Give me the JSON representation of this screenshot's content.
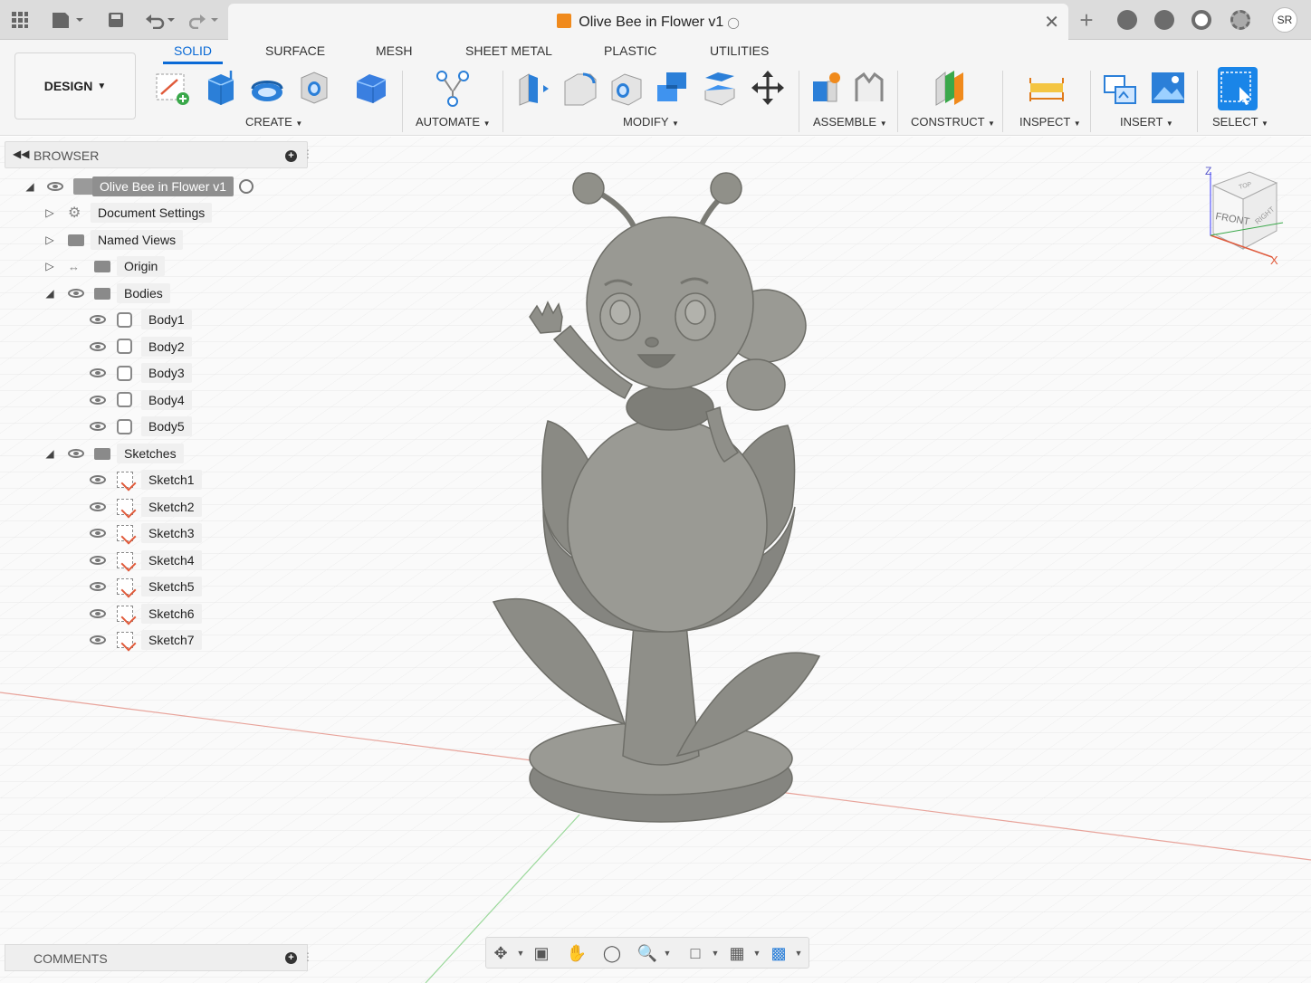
{
  "titlebar": {
    "document_title": "Olive Bee in Flower v1",
    "user_initials": "SR",
    "icons": [
      "apps-grid-icon",
      "file-icon",
      "save-icon",
      "undo-icon",
      "redo-icon",
      "new-tab-plus-icon",
      "job-status-icon",
      "notifications-icon",
      "help-icon",
      "settings-icon"
    ]
  },
  "toolbar": {
    "workspace": "DESIGN",
    "tabs": [
      "SOLID",
      "SURFACE",
      "MESH",
      "SHEET METAL",
      "PLASTIC",
      "UTILITIES"
    ],
    "active_tab": "SOLID",
    "groups": [
      "CREATE",
      "AUTOMATE",
      "MODIFY",
      "ASSEMBLE",
      "CONSTRUCT",
      "INSPECT",
      "INSERT",
      "SELECT"
    ],
    "accent": "#0a6ad6"
  },
  "browser": {
    "title": "BROWSER",
    "root": "Olive Bee in Flower v1",
    "items": {
      "document_settings": "Document Settings",
      "named_views": "Named Views",
      "origin": "Origin",
      "bodies": "Bodies",
      "sketches": "Sketches"
    },
    "bodies": [
      "Body1",
      "Body2",
      "Body3",
      "Body4",
      "Body5"
    ],
    "sketches": [
      "Sketch1",
      "Sketch2",
      "Sketch3",
      "Sketch4",
      "Sketch5",
      "Sketch6",
      "Sketch7"
    ]
  },
  "comments": {
    "title": "COMMENTS"
  },
  "viewcube": {
    "front": "FRONT",
    "right": "RIGHT",
    "top": "TOP",
    "axis_z": "Z",
    "axis_x": "X"
  },
  "model": {
    "color": "#8a8a84"
  }
}
